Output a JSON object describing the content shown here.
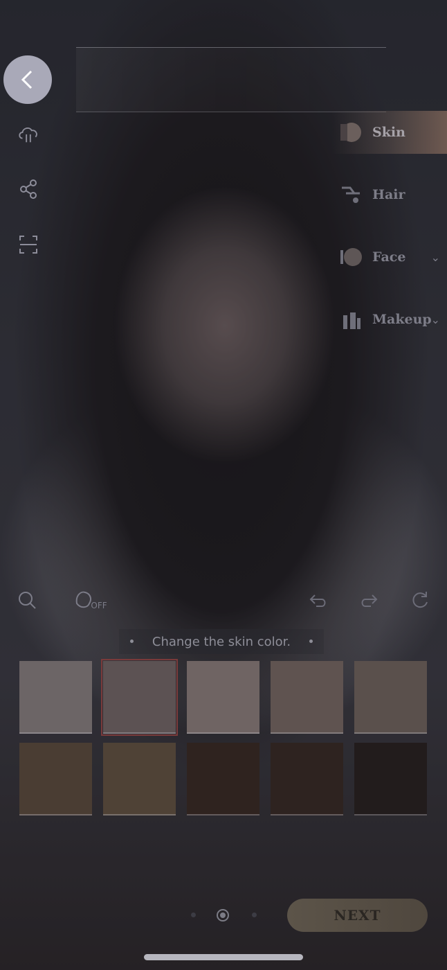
{
  "sidebar": {
    "back_icon": "chevron-left-icon",
    "icons": [
      "cloud-sync-icon",
      "share-icon",
      "scan-icon"
    ]
  },
  "categories": [
    {
      "label": "Skin",
      "icon": "skin-icon",
      "active": true,
      "has_chevron": false
    },
    {
      "label": "Hair",
      "icon": "hair-icon",
      "active": false,
      "has_chevron": false
    },
    {
      "label": "Face",
      "icon": "face-icon",
      "active": false,
      "has_chevron": true
    },
    {
      "label": "Makeup",
      "icon": "makeup-icon",
      "active": false,
      "has_chevron": true
    }
  ],
  "toolbar": {
    "zoom_icon": "search-icon",
    "hair_toggle_label": "OFF",
    "undo_icon": "undo-icon",
    "redo_icon": "redo-icon",
    "reset_icon": "reset-icon"
  },
  "hint": "Change the skin color.",
  "swatches": {
    "colors": [
      "#6c6566",
      "#5c5253",
      "#6f6463",
      "#5f5350",
      "#5a504c",
      "#4a3d33",
      "#4f4236",
      "#2f231f",
      "#2e2320",
      "#221c1c"
    ],
    "selected_index": 1
  },
  "pager": {
    "total": 3,
    "current": 2
  },
  "next_label": "NEXT"
}
